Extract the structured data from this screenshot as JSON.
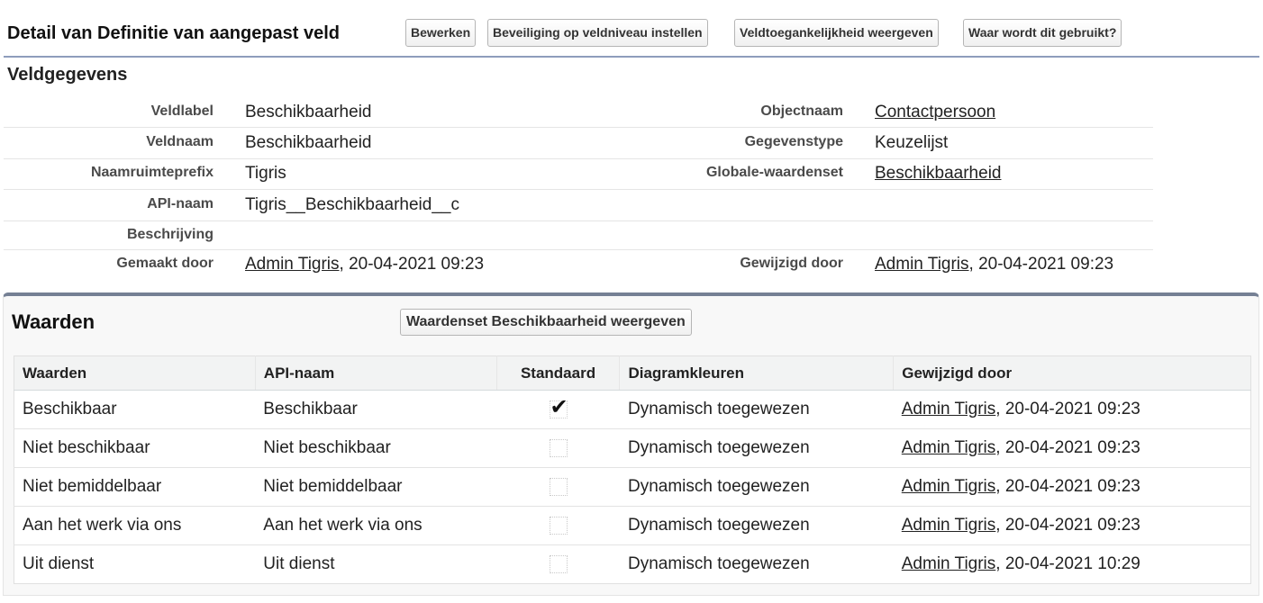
{
  "header": {
    "title": "Detail van Definitie van aangepast veld",
    "buttons": {
      "edit": "Bewerken",
      "field_security": "Beveiliging op veldniveau instellen",
      "field_access": "Veldtoegankelijkheid weergeven",
      "where_used": "Waar wordt dit gebruikt?"
    }
  },
  "field_info": {
    "title": "Veldgegevens",
    "field_label": {
      "label": "Veldlabel",
      "value": "Beschikbaarheid"
    },
    "field_name": {
      "label": "Veldnaam",
      "value": "Beschikbaarheid"
    },
    "namespace_prefix": {
      "label": "Naamruimteprefix",
      "value": "Tigris"
    },
    "api_name": {
      "label": "API-naam",
      "value": "Tigris__Beschikbaarheid__c"
    },
    "description": {
      "label": "Beschrijving",
      "value": ""
    },
    "created_by": {
      "label": "Gemaakt door",
      "user": "Admin Tigris",
      "date": ", 20-04-2021 09:23"
    },
    "object_name": {
      "label": "Objectnaam",
      "value": "Contactpersoon"
    },
    "data_type": {
      "label": "Gegevenstype",
      "value": "Keuzelijst"
    },
    "global_value_set": {
      "label": "Globale-waardenset",
      "value": "Beschikbaarheid"
    },
    "modified_by": {
      "label": "Gewijzigd door",
      "user": "Admin Tigris",
      "date": ", 20-04-2021 09:23"
    }
  },
  "values_panel": {
    "title": "Waarden",
    "view_set_button": "Waardenset Beschikbaarheid weergeven",
    "columns": [
      "Waarden",
      "API-naam",
      "Standaard",
      "Diagramkleuren",
      "Gewijzigd door"
    ],
    "rows": [
      {
        "value": "Beschikbaar",
        "api": "Beschikbaar",
        "default": true,
        "color": "Dynamisch toegewezen",
        "user": "Admin Tigris",
        "date": ", 20-04-2021 09:23"
      },
      {
        "value": "Niet beschikbaar",
        "api": "Niet beschikbaar",
        "default": false,
        "color": "Dynamisch toegewezen",
        "user": "Admin Tigris",
        "date": ", 20-04-2021 09:23"
      },
      {
        "value": "Niet bemiddelbaar",
        "api": "Niet bemiddelbaar",
        "default": false,
        "color": "Dynamisch toegewezen",
        "user": "Admin Tigris",
        "date": ", 20-04-2021 09:23"
      },
      {
        "value": "Aan het werk via ons",
        "api": "Aan het werk via ons",
        "default": false,
        "color": "Dynamisch toegewezen",
        "user": "Admin Tigris",
        "date": ", 20-04-2021 09:23"
      },
      {
        "value": "Uit dienst",
        "api": "Uit dienst",
        "default": false,
        "color": "Dynamisch toegewezen",
        "user": "Admin Tigris",
        "date": ", 20-04-2021 10:29"
      }
    ],
    "check_glyph": "✔"
  }
}
